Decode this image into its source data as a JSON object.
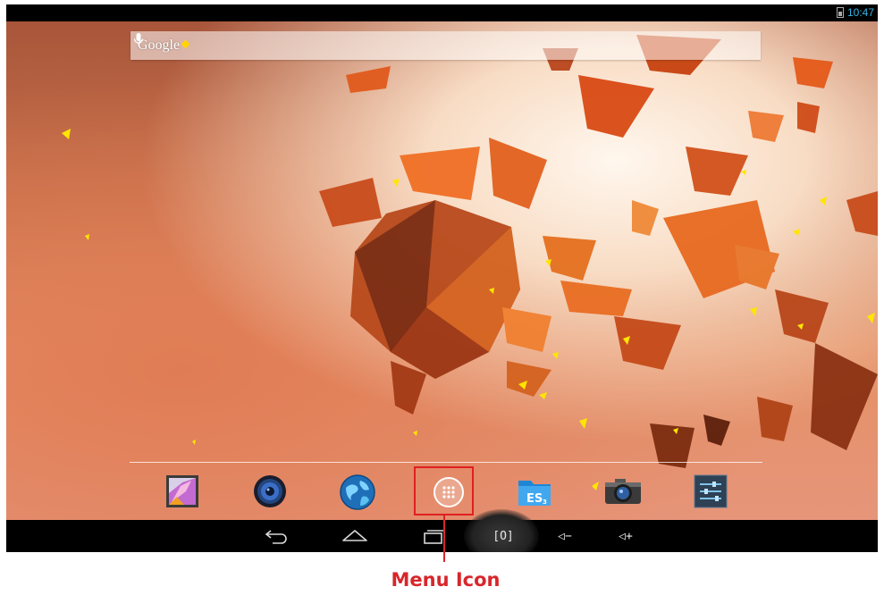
{
  "status_bar": {
    "time": "10:47",
    "time_color": "#33b5e5",
    "battery_icon": "battery-icon"
  },
  "search": {
    "logo_text": "Google",
    "mic_icon": "mic-icon"
  },
  "dock": {
    "items": [
      {
        "name": "gallery-app-icon"
      },
      {
        "name": "music-app-icon"
      },
      {
        "name": "browser-app-icon"
      },
      {
        "name": "app-drawer-menu-icon"
      },
      {
        "name": "es-file-explorer-app-icon"
      },
      {
        "name": "camera-app-icon"
      },
      {
        "name": "settings-app-icon"
      }
    ]
  },
  "navigation": {
    "buttons": [
      {
        "name": "back-button",
        "icon": "back-arrow-icon"
      },
      {
        "name": "home-button",
        "icon": "home-icon"
      },
      {
        "name": "recent-apps-button",
        "icon": "recent-apps-icon"
      },
      {
        "name": "screenshot-button",
        "label": "[O]"
      },
      {
        "name": "volume-down-button",
        "label": "◁−"
      },
      {
        "name": "volume-up-button",
        "label": "◁+"
      }
    ]
  },
  "annotation": {
    "label": "Menu Icon",
    "color": "#d8262b"
  }
}
